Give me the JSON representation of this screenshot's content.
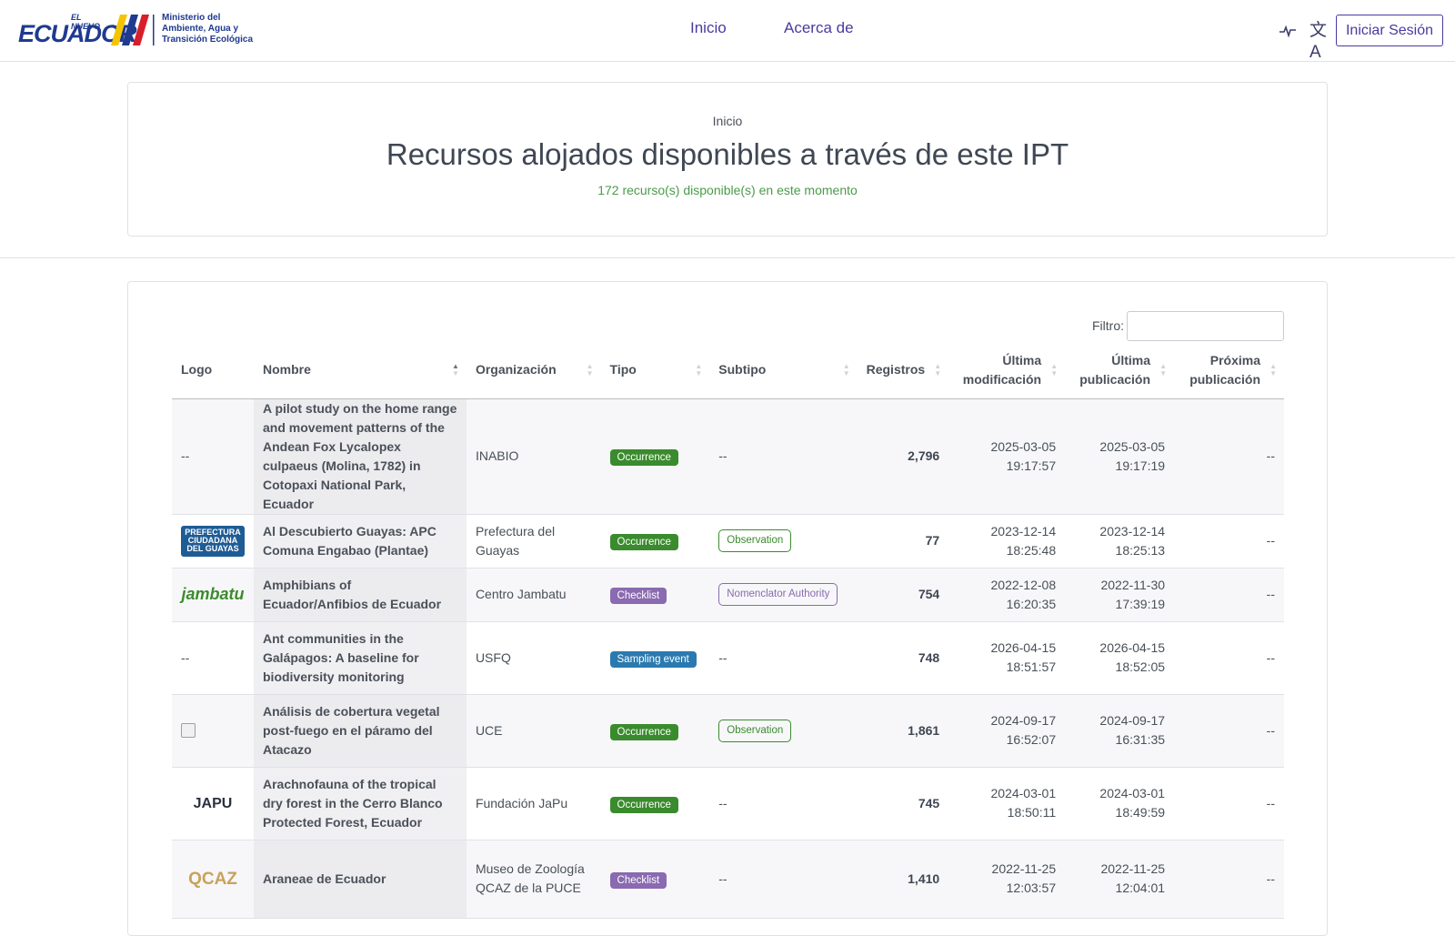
{
  "header": {
    "logo": {
      "prefix": "EL NUEVO",
      "country": "ECUADOR",
      "ministry": "Ministerio del Ambiente, Agua y Transición Ecológica"
    },
    "nav": [
      "Inicio",
      "Acerca de"
    ],
    "login_label": "Iniciar Sesión"
  },
  "hero": {
    "breadcrumb": "Inicio",
    "title": "Recursos alojados disponibles a través de este IPT",
    "subtitle": "172 recurso(s) disponible(s) en este momento"
  },
  "filter": {
    "label": "Filtro:",
    "value": ""
  },
  "table": {
    "headers": {
      "logo": "Logo",
      "name": "Nombre",
      "org": "Organización",
      "type": "Tipo",
      "subtype": "Subtipo",
      "records": "Registros",
      "modified": "Última modificación",
      "published": "Última publicación",
      "next": "Próxima publicación"
    },
    "rows": [
      {
        "logo": "--",
        "name": "A pilot study on the home range and movement patterns of the Andean Fox Lycalopex culpaeus (Molina, 1782) in Cotopaxi National Park, Ecuador",
        "org": "INABIO",
        "type": "Occurrence",
        "subtype": "--",
        "records": "2,796",
        "modified": "2025-03-05 19:17:57",
        "published": "2025-03-05 19:17:19",
        "next": "--"
      },
      {
        "logo": "PREFECTURA CIUDADANA DEL GUAYAS",
        "name": "Al Descubierto Guayas: APC Comuna Engabao (Plantae)",
        "org": "Prefectura del Guayas",
        "type": "Occurrence",
        "subtype": "Observation",
        "records": "77",
        "modified": "2023-12-14 18:25:48",
        "published": "2023-12-14 18:25:13",
        "next": "--"
      },
      {
        "logo": "jambatu",
        "name": "Amphibians of Ecuador/Anfibios de Ecuador",
        "org": "Centro Jambatu",
        "type": "Checklist",
        "subtype": "Nomenclator Authority",
        "records": "754",
        "modified": "2022-12-08 16:20:35",
        "published": "2022-11-30 17:39:19",
        "next": "--"
      },
      {
        "logo": "--",
        "name": "Ant communities in the Galápagos: A baseline for biodiversity monitoring",
        "org": "USFQ",
        "type": "Sampling event",
        "subtype": "--",
        "records": "748",
        "modified": "2026-04-15 18:51:57",
        "published": "2026-04-15 18:52:05",
        "next": "--"
      },
      {
        "logo": "",
        "name": "Análisis de cobertura vegetal post-fuego en el páramo del Atacazo",
        "org": "UCE",
        "type": "Occurrence",
        "subtype": "Observation",
        "records": "1,861",
        "modified": "2024-09-17 16:52:07",
        "published": "2024-09-17 16:31:35",
        "next": "--"
      },
      {
        "logo": "JAPU",
        "name": "Arachnofauna of the tropical dry forest in the Cerro Blanco Protected Forest, Ecuador",
        "org": "Fundación JaPu",
        "type": "Occurrence",
        "subtype": "--",
        "records": "745",
        "modified": "2024-03-01 18:50:11",
        "published": "2024-03-01 18:49:59",
        "next": "--"
      },
      {
        "logo": "QCAZ",
        "name": "Araneae de Ecuador",
        "org": "Museo de Zoología QCAZ de la PUCE",
        "type": "Checklist",
        "subtype": "--",
        "records": "1,410",
        "modified": "2022-11-25 12:03:57",
        "published": "2022-11-25 12:04:01",
        "next": "--"
      }
    ]
  },
  "colors": {
    "accent": "#4a3aa0",
    "occurrence": "#3a8b2d",
    "checklist": "#8a6ab0",
    "sampling": "#2a7ab0",
    "available": "#4a9b48"
  }
}
